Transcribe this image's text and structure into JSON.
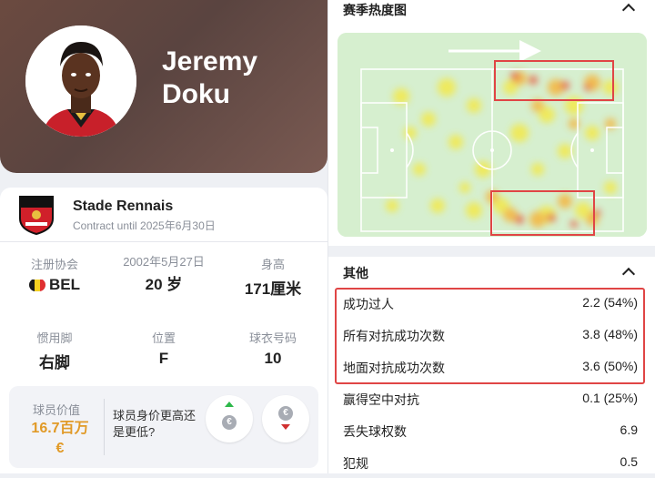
{
  "player": {
    "first_name": "Jeremy",
    "last_name": "Doku"
  },
  "club": {
    "name": "Stade Rennais",
    "contract": "Contract until 2025年6月30日"
  },
  "stats": [
    {
      "label": "注册协会",
      "value": "BEL"
    },
    {
      "label": "2002年5月27日",
      "value": "20 岁"
    },
    {
      "label": "身高",
      "value": "171厘米"
    },
    {
      "label": "惯用脚",
      "value": "右脚"
    },
    {
      "label": "位置",
      "value": "F"
    },
    {
      "label": "球衣号码",
      "value": "10"
    }
  ],
  "market_value": {
    "label": "球员价值",
    "value": "16.7百万 €",
    "question": "球员身价更高还是更低?",
    "up_icon": "coin-up-icon",
    "down_icon": "coin-down-icon"
  },
  "heatmap_section": {
    "title": "赛季热度图"
  },
  "other_section": {
    "title": "其他",
    "rows": [
      {
        "label": "成功过人",
        "value": "2.2 (54%)"
      },
      {
        "label": "所有对抗成功次数",
        "value": "3.8 (48%)"
      },
      {
        "label": "地面对抗成功次数",
        "value": "3.6 (50%)"
      },
      {
        "label": "赢得空中对抗",
        "value": "0.1 (25%)"
      },
      {
        "label": "丢失球权数",
        "value": "6.9"
      },
      {
        "label": "犯规",
        "value": "0.5"
      }
    ]
  },
  "colors": {
    "accent_orange": "#e19a27",
    "highlight_red": "#e04545",
    "pitch_green": "#d6efcf",
    "belgium_flag": [
      "#1a1a1a",
      "#f5d020",
      "#e03030"
    ]
  }
}
